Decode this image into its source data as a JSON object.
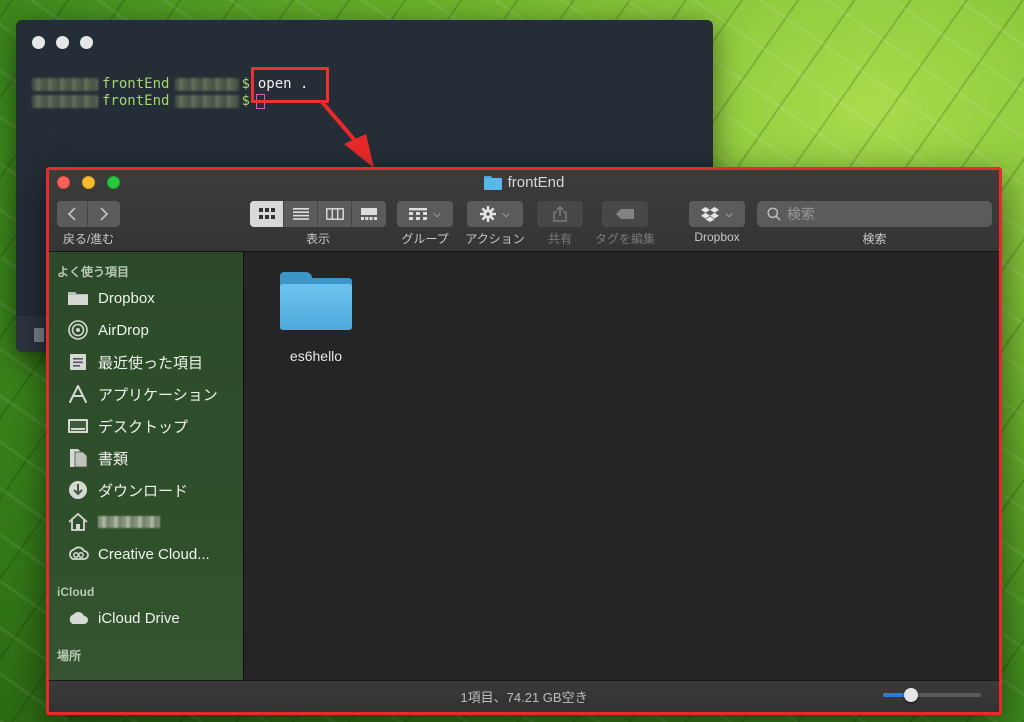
{
  "terminal": {
    "lines": [
      {
        "dir": "frontEnd",
        "prompt": "$",
        "command": "open ."
      },
      {
        "dir": "frontEnd",
        "prompt": "$",
        "command": ""
      }
    ]
  },
  "finder": {
    "title": "frontEnd",
    "toolbar": {
      "nav_label": "戻る/進む",
      "view_label": "表示",
      "group_label": "グループ",
      "action_label": "アクション",
      "share_label": "共有",
      "tag_label": "タグを編集",
      "dropbox_label": "Dropbox",
      "search_label": "検索",
      "search_placeholder": "検索",
      "active_view": "icon"
    },
    "sidebar": {
      "favorites_heading": "よく使う項目",
      "favorites": [
        {
          "label": "Dropbox",
          "icon": "folder-icon"
        },
        {
          "label": "AirDrop",
          "icon": "airdrop-icon"
        },
        {
          "label": "最近使った項目",
          "icon": "recents-icon"
        },
        {
          "label": "アプリケーション",
          "icon": "applications-icon"
        },
        {
          "label": "デスクトップ",
          "icon": "desktop-icon"
        },
        {
          "label": "書類",
          "icon": "documents-icon"
        },
        {
          "label": "ダウンロード",
          "icon": "downloads-icon"
        },
        {
          "label": "",
          "icon": "home-icon"
        },
        {
          "label": "Creative Cloud...",
          "icon": "creative-cloud-icon"
        }
      ],
      "icloud_heading": "iCloud",
      "icloud": [
        {
          "label": "iCloud Drive",
          "icon": "cloud-icon"
        }
      ],
      "locations_heading": "場所"
    },
    "files": [
      {
        "name": "es6hello",
        "icon": "folder-icon"
      }
    ],
    "status": "1項目、74.21 GB空き",
    "icon_size_slider": 0.25
  },
  "colors": {
    "highlight": "#ea2a2a",
    "folder": "#5ab8ea",
    "terminal_bg": "#252d37"
  }
}
